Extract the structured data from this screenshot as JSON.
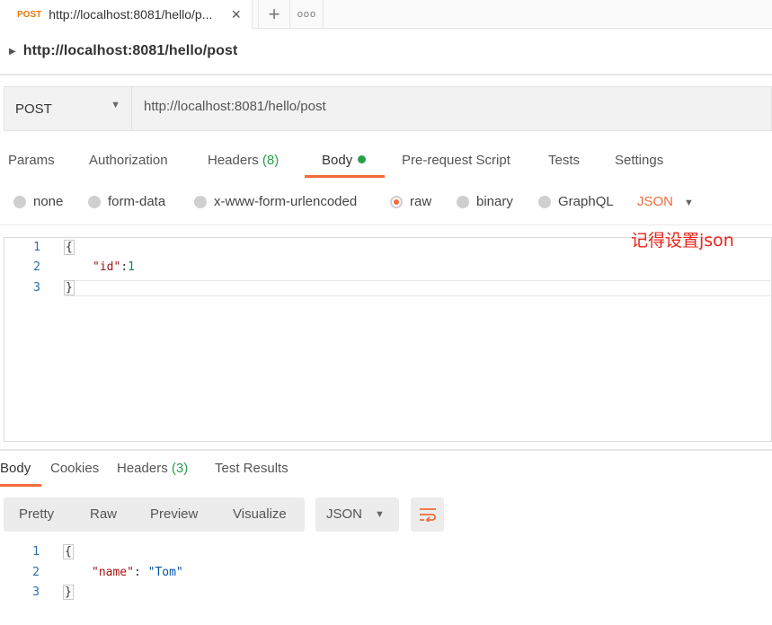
{
  "tab": {
    "method": "POST",
    "title": "http://localhost:8081/hello/p...",
    "close_icon": "×",
    "add_icon": "+",
    "more_icon": "ooo"
  },
  "request": {
    "name": "http://localhost:8081/hello/post",
    "method": "POST",
    "url": "http://localhost:8081/hello/post"
  },
  "request_tabs": [
    {
      "label": "Params",
      "count": ""
    },
    {
      "label": "Authorization",
      "count": ""
    },
    {
      "label": "Headers",
      "count": "(8)"
    },
    {
      "label": "Body",
      "count": ""
    },
    {
      "label": "Pre-request Script",
      "count": ""
    },
    {
      "label": "Tests",
      "count": ""
    },
    {
      "label": "Settings",
      "count": ""
    }
  ],
  "body_types": [
    {
      "label": "none",
      "selected": false
    },
    {
      "label": "form-data",
      "selected": false
    },
    {
      "label": "x-www-form-urlencoded",
      "selected": false
    },
    {
      "label": "raw",
      "selected": true
    },
    {
      "label": "binary",
      "selected": false
    },
    {
      "label": "GraphQL",
      "selected": false
    }
  ],
  "raw_language": "JSON",
  "annotation": "记得设置json",
  "request_body": {
    "line_numbers": [
      "1",
      "2",
      "3"
    ],
    "open": "{",
    "key": "\"id\"",
    "colon": ":",
    "value": "1",
    "close": "}"
  },
  "response_tabs": [
    {
      "label": "Body",
      "count": ""
    },
    {
      "label": "Cookies",
      "count": ""
    },
    {
      "label": "Headers",
      "count": "(3)"
    },
    {
      "label": "Test Results",
      "count": ""
    }
  ],
  "view_modes": [
    "Pretty",
    "Raw",
    "Preview",
    "Visualize"
  ],
  "response_format": "JSON",
  "response_body": {
    "line_numbers": [
      "1",
      "2",
      "3"
    ],
    "open": "{",
    "key": "\"name\"",
    "colon": ": ",
    "value": "\"Tom\"",
    "close": "}"
  },
  "colors": {
    "accent": "#f26b3a",
    "method": "#e8790f",
    "success": "#27a04a",
    "annotation": "#e8231a"
  }
}
